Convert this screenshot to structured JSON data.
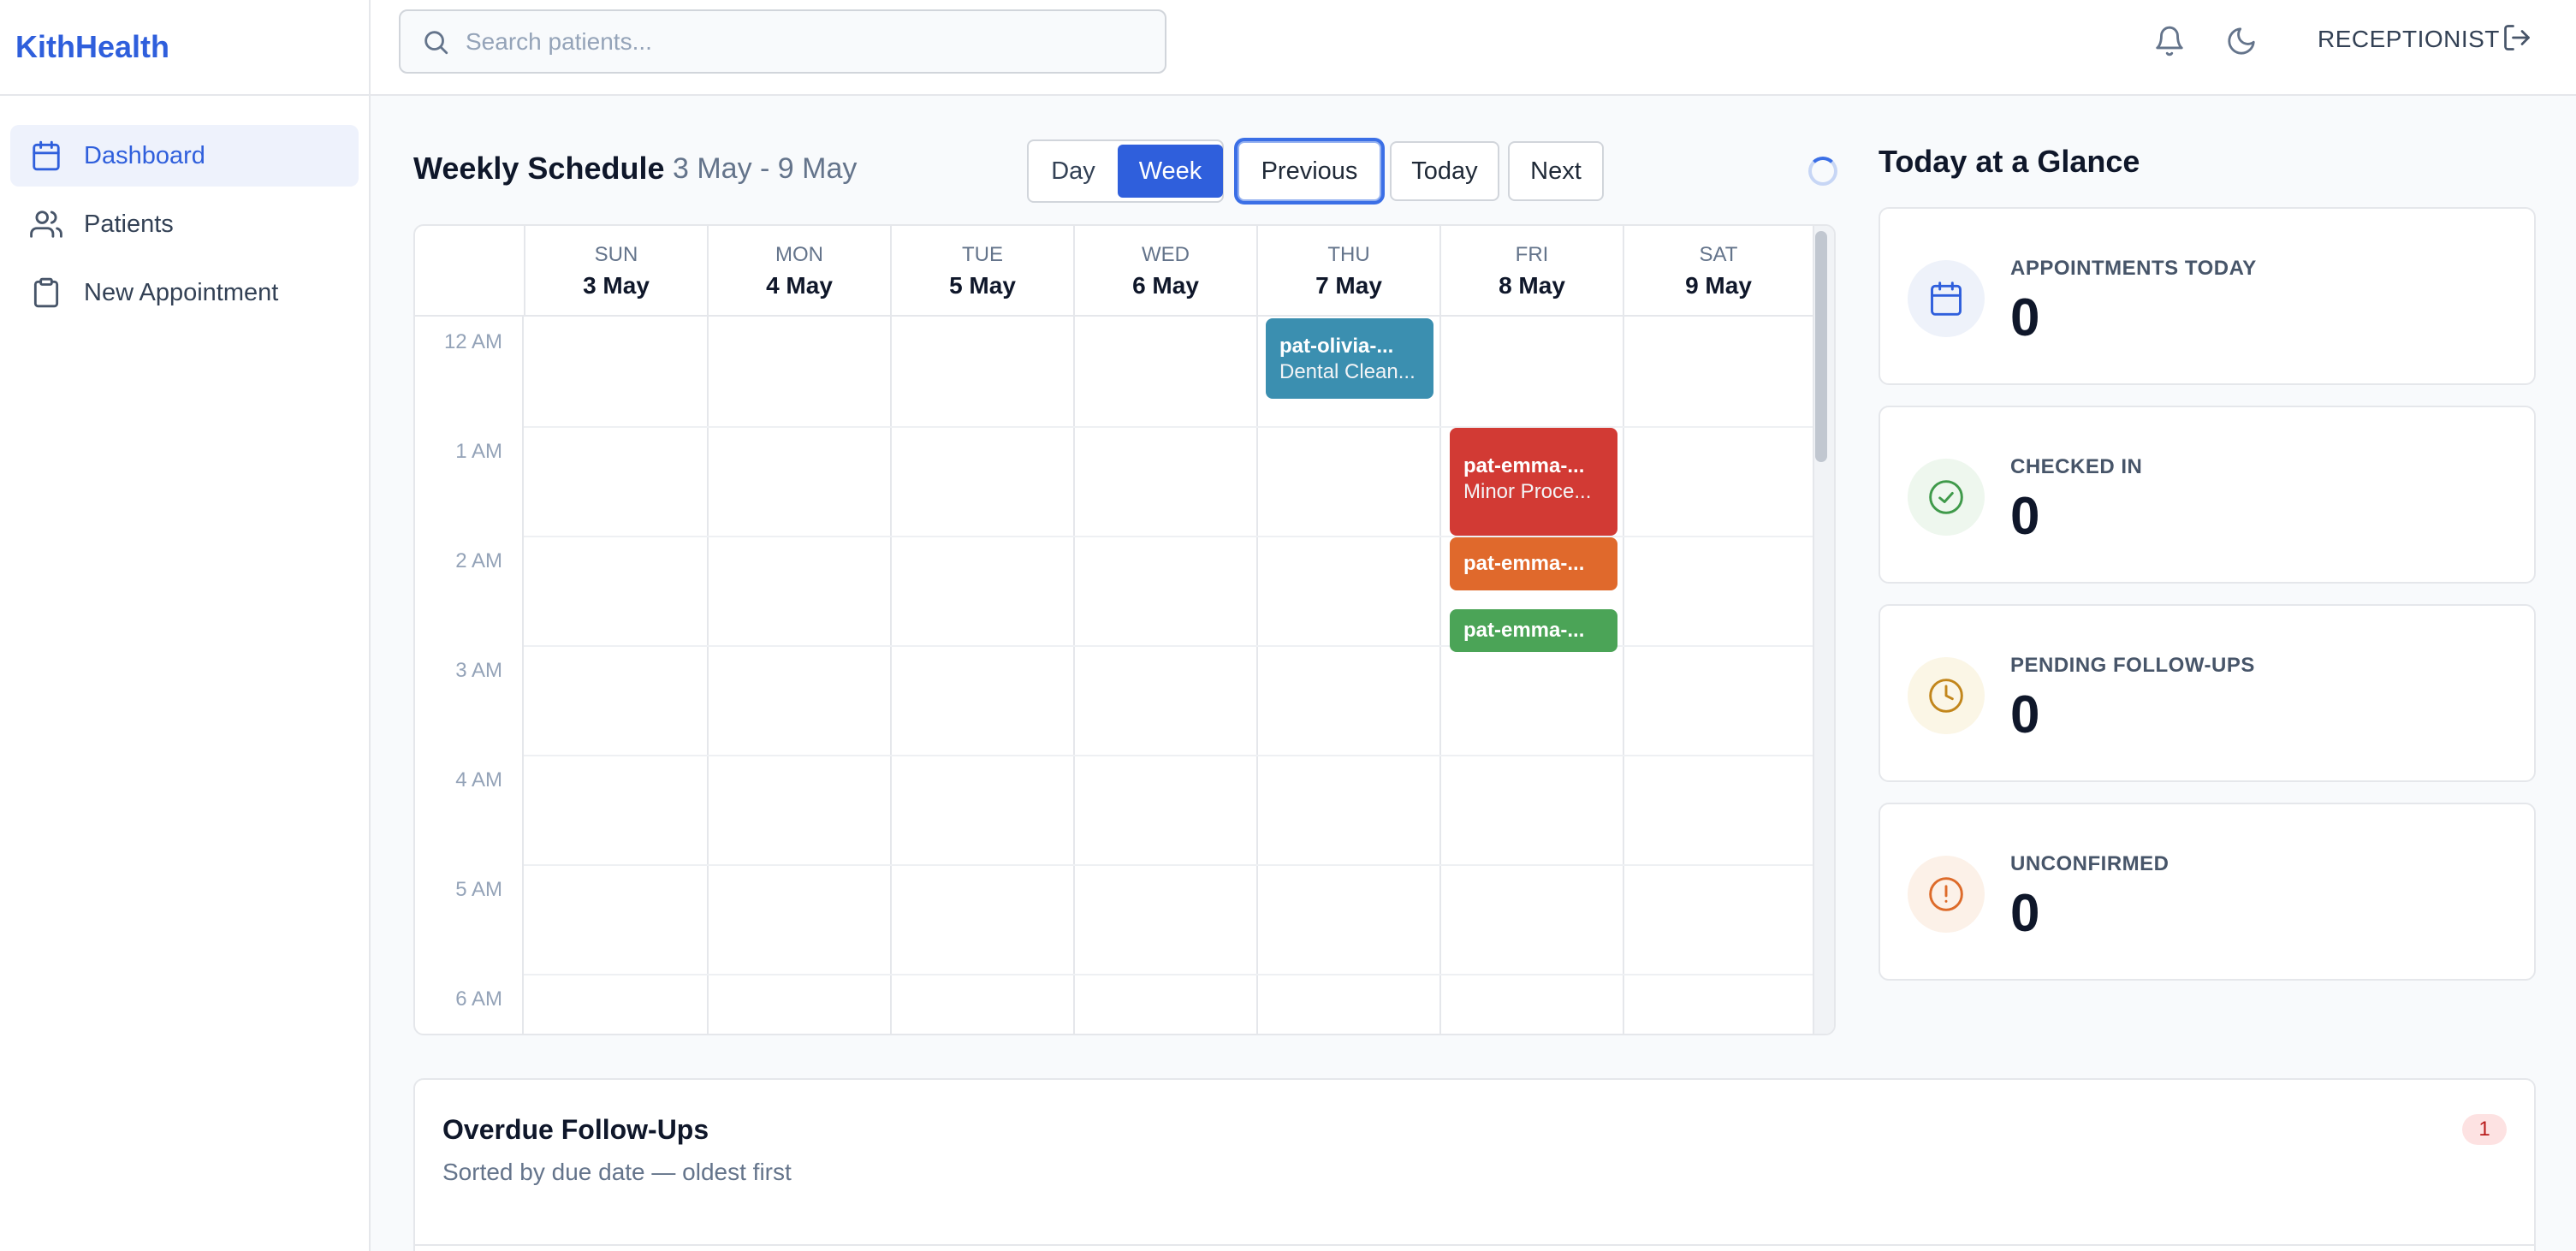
{
  "app": {
    "brand": "KithHealth"
  },
  "sidebar": {
    "items": [
      {
        "label": "Dashboard",
        "icon": "calendar-icon",
        "active": true
      },
      {
        "label": "Patients",
        "icon": "users-icon",
        "active": false
      },
      {
        "label": "New Appointment",
        "icon": "clipboard-icon",
        "active": false
      }
    ]
  },
  "topbar": {
    "search_placeholder": "Search patients...",
    "role": "RECEPTIONIST"
  },
  "schedule": {
    "title": "Weekly Schedule",
    "range": "3 May - 9 May",
    "view_day": "Day",
    "view_week": "Week",
    "prev": "Previous",
    "today": "Today",
    "next": "Next",
    "days": [
      {
        "dow": "SUN",
        "date": "3 May"
      },
      {
        "dow": "MON",
        "date": "4 May"
      },
      {
        "dow": "TUE",
        "date": "5 May"
      },
      {
        "dow": "WED",
        "date": "6 May"
      },
      {
        "dow": "THU",
        "date": "7 May"
      },
      {
        "dow": "FRI",
        "date": "8 May"
      },
      {
        "dow": "SAT",
        "date": "9 May"
      }
    ],
    "hours": [
      "12 AM",
      "1 AM",
      "2 AM",
      "3 AM",
      "4 AM",
      "5 AM",
      "6 AM"
    ],
    "events": [
      {
        "line1": "pat-olivia-...",
        "line2": "Dental Clean...",
        "color": "#3b8fb0"
      },
      {
        "line1": "pat-emma-...",
        "line2": "Minor Proce...",
        "color": "#d23a34"
      },
      {
        "line1": "pat-emma-...",
        "line2": "",
        "color": "#e0692c"
      },
      {
        "line1": "pat-emma-...",
        "line2": "",
        "color": "#4ba457"
      }
    ]
  },
  "glance": {
    "title": "Today at a Glance",
    "cards": [
      {
        "label": "APPOINTMENTS TODAY",
        "value": "0",
        "icon": "calendar-icon",
        "color": "#2f5fdc",
        "bg": "#eef2fa"
      },
      {
        "label": "CHECKED IN",
        "value": "0",
        "icon": "check-circle-icon",
        "color": "#3f9a4a",
        "bg": "#eef7ee"
      },
      {
        "label": "PENDING FOLLOW-UPS",
        "value": "0",
        "icon": "clock-icon",
        "color": "#c2861b",
        "bg": "#fbf6e6"
      },
      {
        "label": "UNCONFIRMED",
        "value": "0",
        "icon": "alert-circle-icon",
        "color": "#dd6b2a",
        "bg": "#fcf1e8"
      }
    ]
  },
  "overdue": {
    "title": "Overdue Follow-Ups",
    "subtitle": "Sorted by due date — oldest first",
    "count": "1"
  }
}
